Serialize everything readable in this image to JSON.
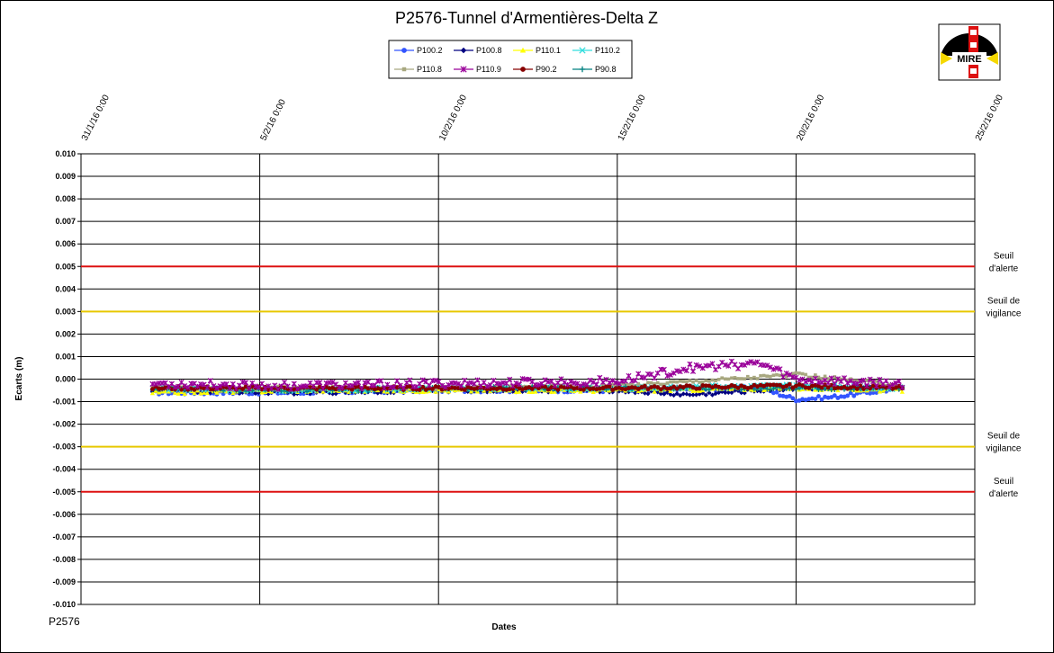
{
  "chart_data": {
    "type": "scatter",
    "title": "P2576-Tunnel  d'Armentières-Delta  Z",
    "xlabel": "Dates",
    "ylabel": "Ecarts (m)",
    "footer": "P2576",
    "logo_text": "MIRE",
    "ylim": [
      -0.01,
      0.01
    ],
    "yticks": [
      "0.010",
      "0.009",
      "0.008",
      "0.007",
      "0.006",
      "0.005",
      "0.004",
      "0.003",
      "0.002",
      "0.001",
      "0.000",
      "-0.001",
      "-0.002",
      "-0.003",
      "-0.004",
      "-0.005",
      "-0.006",
      "-0.007",
      "-0.008",
      "-0.009",
      "-0.010"
    ],
    "xlim": [
      "2016-01-31",
      "2016-02-25"
    ],
    "xticks": [
      {
        "date": "2016-01-31",
        "label": "31/1/16 0:00"
      },
      {
        "date": "2016-02-05",
        "label": "5/2/16 0:00"
      },
      {
        "date": "2016-02-10",
        "label": "10/2/16 0:00"
      },
      {
        "date": "2016-02-15",
        "label": "15/2/16 0:00"
      },
      {
        "date": "2016-02-20",
        "label": "20/2/16 0:00"
      },
      {
        "date": "2016-02-25",
        "label": "25/2/16 0:00"
      }
    ],
    "grid": true,
    "legend_position": "top-center",
    "thresholds": [
      {
        "value": 0.005,
        "label_line1": "Seuil",
        "label_line2": "d'alerte",
        "color": "#dd1111"
      },
      {
        "value": 0.003,
        "label_line1": "Seuil de",
        "label_line2": "vigilance",
        "color": "#e8c800"
      },
      {
        "value": -0.003,
        "label_line1": "Seuil de",
        "label_line2": "vigilance",
        "color": "#e8c800"
      },
      {
        "value": -0.005,
        "label_line1": "Seuil",
        "label_line2": "d'alerte",
        "color": "#dd1111"
      }
    ],
    "data_range": {
      "start": "2016-02-02",
      "end": "2016-02-23"
    },
    "series": [
      {
        "name": "P100.2",
        "color": "#3355ff",
        "marker": "circle",
        "values": [
          {
            "date": "2016-02-02",
            "y": -0.0006
          },
          {
            "date": "2016-02-06",
            "y": -0.0006
          },
          {
            "date": "2016-02-10",
            "y": -0.0005
          },
          {
            "date": "2016-02-15",
            "y": -0.0005
          },
          {
            "date": "2016-02-19",
            "y": -0.0004
          },
          {
            "date": "2016-02-20",
            "y": -0.0009
          },
          {
            "date": "2016-02-21",
            "y": -0.0008
          },
          {
            "date": "2016-02-23",
            "y": -0.0004
          }
        ]
      },
      {
        "name": "P100.8",
        "color": "#000080",
        "marker": "diamond",
        "values": [
          {
            "date": "2016-02-02",
            "y": -0.0005
          },
          {
            "date": "2016-02-06",
            "y": -0.0006
          },
          {
            "date": "2016-02-10",
            "y": -0.0005
          },
          {
            "date": "2016-02-15",
            "y": -0.0005
          },
          {
            "date": "2016-02-17",
            "y": -0.0007
          },
          {
            "date": "2016-02-20",
            "y": -0.0004
          },
          {
            "date": "2016-02-23",
            "y": -0.0004
          }
        ]
      },
      {
        "name": "P110.1",
        "color": "#ffff00",
        "marker": "triangle",
        "values": [
          {
            "date": "2016-02-02",
            "y": -0.0006
          },
          {
            "date": "2016-02-06",
            "y": -0.0005
          },
          {
            "date": "2016-02-10",
            "y": -0.0005
          },
          {
            "date": "2016-02-15",
            "y": -0.0005
          },
          {
            "date": "2016-02-20",
            "y": -0.0004
          },
          {
            "date": "2016-02-23",
            "y": -0.0005
          }
        ]
      },
      {
        "name": "P110.2",
        "color": "#33dddd",
        "marker": "x",
        "values": [
          {
            "date": "2016-02-02",
            "y": -0.0004
          },
          {
            "date": "2016-02-06",
            "y": -0.0005
          },
          {
            "date": "2016-02-10",
            "y": -0.0004
          },
          {
            "date": "2016-02-15",
            "y": -0.0004
          },
          {
            "date": "2016-02-20",
            "y": -0.0003
          },
          {
            "date": "2016-02-23",
            "y": -0.0004
          }
        ]
      },
      {
        "name": "P110.8",
        "color": "#a8a880",
        "marker": "square",
        "values": [
          {
            "date": "2016-02-02",
            "y": -0.0004
          },
          {
            "date": "2016-02-06",
            "y": -0.0004
          },
          {
            "date": "2016-02-10",
            "y": -0.0004
          },
          {
            "date": "2016-02-15",
            "y": -0.0003
          },
          {
            "date": "2016-02-20",
            "y": 0.0002
          },
          {
            "date": "2016-02-23",
            "y": -0.0003
          }
        ]
      },
      {
        "name": "P110.9",
        "color": "#990099",
        "marker": "star",
        "values": [
          {
            "date": "2016-02-02",
            "y": -0.0002
          },
          {
            "date": "2016-02-06",
            "y": -0.0003
          },
          {
            "date": "2016-02-10",
            "y": -0.0002
          },
          {
            "date": "2016-02-15",
            "y": -0.0001
          },
          {
            "date": "2016-02-17",
            "y": 0.0005
          },
          {
            "date": "2016-02-19",
            "y": 0.0007
          },
          {
            "date": "2016-02-20",
            "y": 0.0
          },
          {
            "date": "2016-02-23",
            "y": -0.0002
          }
        ]
      },
      {
        "name": "P90.2",
        "color": "#880000",
        "marker": "circle",
        "values": [
          {
            "date": "2016-02-02",
            "y": -0.0004
          },
          {
            "date": "2016-02-06",
            "y": -0.0004
          },
          {
            "date": "2016-02-10",
            "y": -0.0004
          },
          {
            "date": "2016-02-15",
            "y": -0.0004
          },
          {
            "date": "2016-02-20",
            "y": -0.0003
          },
          {
            "date": "2016-02-23",
            "y": -0.0004
          }
        ]
      },
      {
        "name": "P90.8",
        "color": "#008080",
        "marker": "plus",
        "values": [
          {
            "date": "2016-02-02",
            "y": -0.0004
          },
          {
            "date": "2016-02-06",
            "y": -0.0005
          },
          {
            "date": "2016-02-10",
            "y": -0.0004
          },
          {
            "date": "2016-02-15",
            "y": -0.0004
          },
          {
            "date": "2016-02-20",
            "y": -0.0004
          },
          {
            "date": "2016-02-23",
            "y": -0.0004
          }
        ]
      }
    ]
  }
}
